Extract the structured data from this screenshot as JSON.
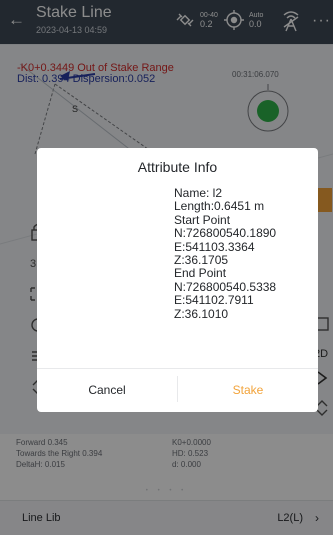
{
  "header": {
    "title": "Stake Line",
    "subtitle": "2023-04-13 04:59",
    "satellites": {
      "top": "00-40",
      "bottom": "0.2"
    },
    "gps": {
      "top": "Auto",
      "bottom": "0.0"
    },
    "icons": {
      "back": "back-arrow-icon",
      "satellite": "satellite-icon",
      "gps": "gps-icon",
      "radio": "radio-icon",
      "more": "more-icon"
    }
  },
  "map": {
    "stake_status": "-K0+0.3449 Out of Stake Range",
    "stake_dist": "Dist: 0.394 Dispersion:0.052",
    "time": "00:31:06.070",
    "point_label": "S"
  },
  "dialog": {
    "title": "Attribute Info",
    "lines": [
      "Name:  l2",
      "Length:0.6451 m",
      "Start Point",
      "N:726800540.1890",
      "E:541103.3364",
      "Z:36.1705",
      "End Point",
      "N:726800540.5338",
      "E:541102.7911",
      "Z:36.1010"
    ],
    "cancel_label": "Cancel",
    "stake_label": "Stake",
    "accent_color": "#f2a33a"
  },
  "info": {
    "left": [
      "Forward 0.345",
      "Towards the Right 0.394",
      "DeltaH: 0.015"
    ],
    "right": [
      "K0+0.0000",
      "HD: 0.523",
      "d: 0.000"
    ],
    "pager_dots": "• • • •"
  },
  "footer": {
    "left_label": "Line Lib",
    "right_label": "L2(L)",
    "chevron": "›"
  }
}
